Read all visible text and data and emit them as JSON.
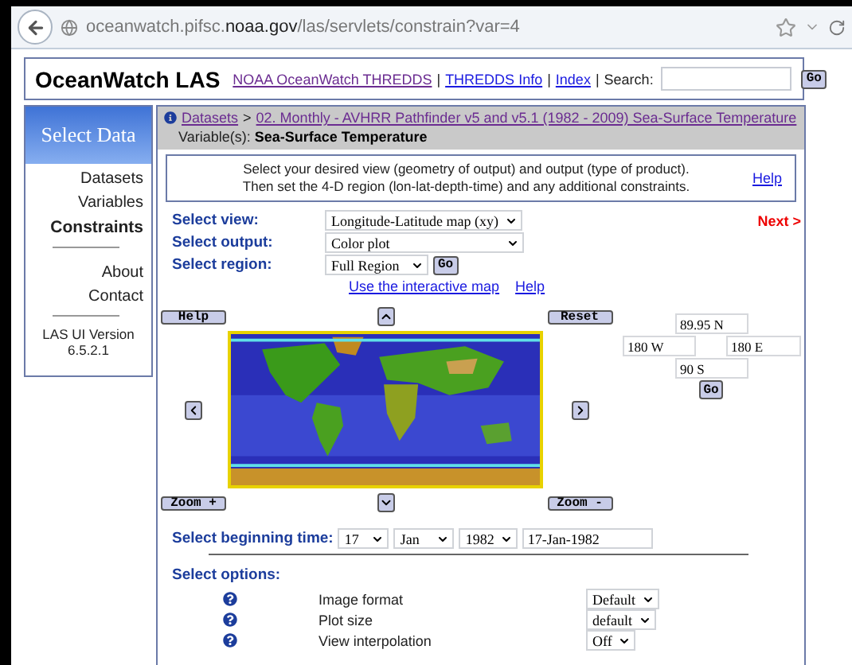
{
  "browser": {
    "url": "oceanwatch.pifsc.**noaa.gov**/las/servlets/constrain?var=4"
  },
  "header": {
    "title": "OceanWatch LAS",
    "separator": "|",
    "links": [
      {
        "label": "NOAA OceanWatch THREDDS",
        "visited": true
      },
      {
        "label": "THREDDS Info",
        "visited": false
      },
      {
        "label": "Index",
        "visited": false
      }
    ],
    "search_label": "Search:",
    "search_button": "Go"
  },
  "sidebar": {
    "heading": "Select Data",
    "sections": [
      {
        "items": [
          {
            "label": "Datasets",
            "selected": false
          },
          {
            "label": "Variables",
            "selected": false
          },
          {
            "label": "Constraints",
            "selected": true
          }
        ]
      },
      {
        "items": [
          {
            "label": "About",
            "selected": false
          },
          {
            "label": "Contact",
            "selected": false
          }
        ]
      }
    ],
    "version": "LAS UI Version 6.5.2.1"
  },
  "breadcrumb": {
    "separator": ">",
    "items": [
      {
        "label": "Datasets"
      },
      {
        "label": "02. Monthly - AVHRR Pathfinder v5 and v5.1 (1982 - 2009) Sea-Surface Temperature"
      }
    ],
    "variable": "Variable(s): **Sea-Surface Temperature**"
  },
  "instructions": {
    "lines": [
      "Select your desired view (geometry of output) and output (type of product).",
      "Then set the 4-D region (lon-lat-depth-time) and any additional constraints."
    ],
    "help": "Help"
  },
  "selectors": [
    {
      "label": "Select view:",
      "value": "Longitude-Latitude map (xy)"
    },
    {
      "label": "Select output:",
      "value": "Color plot"
    },
    {
      "label": "Select region:",
      "value": "Full Region",
      "go": "Go"
    }
  ],
  "next": "Next >",
  "map_links": [
    "Use the interactive map",
    "Help"
  ],
  "map": {
    "help": "Help",
    "reset": "Reset",
    "zoom_in": "Zoom +",
    "zoom_out": "Zoom -",
    "north": "89.95 N",
    "west": "180 W",
    "east": "180 E",
    "south": "90 S",
    "go": "Go"
  },
  "time": {
    "label": "Select beginning time:",
    "day": "17",
    "month": "Jan",
    "year": "1982",
    "date": "17-Jan-1982"
  },
  "options": {
    "label": "Select options:",
    "rows": [
      {
        "label": "Image format",
        "value": "Default"
      },
      {
        "label": "Plot size",
        "value": "default"
      },
      {
        "label": "View interpolation",
        "value": "Off"
      }
    ]
  }
}
